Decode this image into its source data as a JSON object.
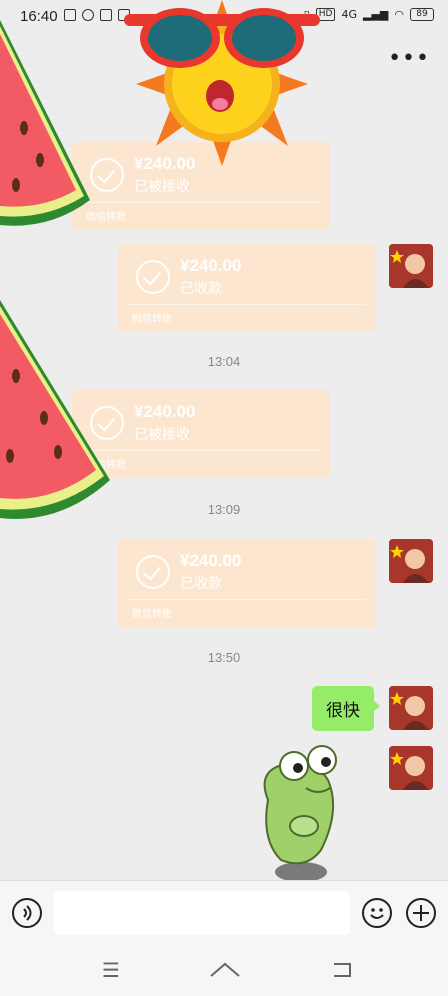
{
  "status_bar": {
    "time": "16:40",
    "network": "4G",
    "hd": "HD",
    "battery": "89"
  },
  "messages": {
    "transfers": [
      {
        "amount": "¥240.00",
        "status": "已被接收",
        "label": "微信转账"
      },
      {
        "amount": "¥240.00",
        "status": "已收款",
        "label": "微信转账"
      },
      {
        "amount": "¥240.00",
        "status": "已被接收",
        "label": "微信转账"
      },
      {
        "amount": "¥240.00",
        "status": "已收款",
        "label": "微信转账"
      }
    ],
    "timestamps": [
      "13:04",
      "13:09",
      "13:50"
    ],
    "text_message": "很快"
  },
  "colors": {
    "background": "#ededed",
    "transfer_card": "#fde6cf",
    "own_bubble": "#95ec69"
  },
  "icons": [
    "back-icon",
    "more-icon",
    "voice-icon",
    "emoji-icon",
    "add-icon",
    "menu-icon",
    "home-icon",
    "back-nav-icon"
  ]
}
